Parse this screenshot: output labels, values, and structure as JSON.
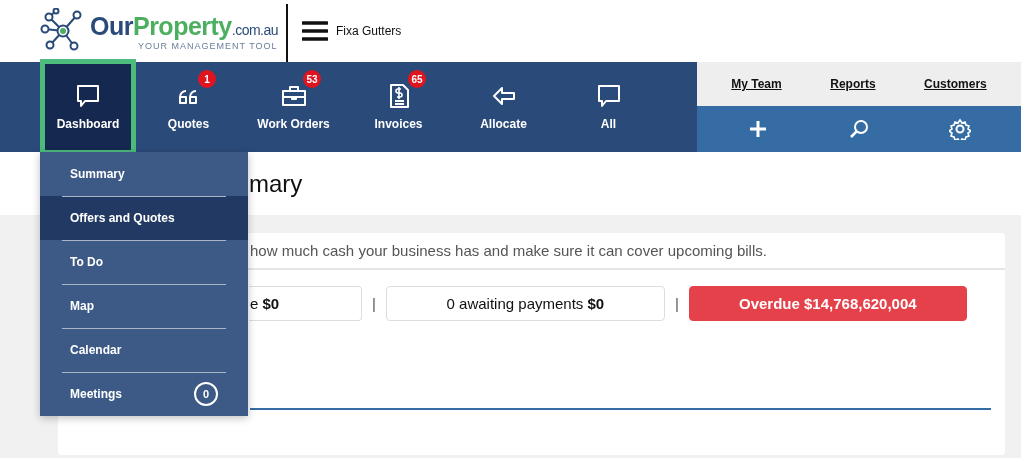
{
  "logo": {
    "brand": "Our",
    "brand_accent": "Property",
    "domain": ".com.au",
    "tagline": "YOUR MANAGEMENT TOOL"
  },
  "company": "Fixa Gutters",
  "nav": [
    {
      "label": "Dashboard",
      "selected": true
    },
    {
      "label": "Quotes",
      "badge": "1",
      "selected": false
    },
    {
      "label": "Work Orders",
      "badge": "53",
      "selected": false
    },
    {
      "label": "Invoices",
      "badge": "65",
      "selected": false
    },
    {
      "label": "Allocate",
      "selected": false
    },
    {
      "label": "All",
      "selected": false
    }
  ],
  "top_links": [
    "My Team",
    "Reports",
    "Customers"
  ],
  "page_title": "mary",
  "invoices_card": {
    "description": "how much cash your business has and make sure it can cover upcoming bills.",
    "stats": [
      {
        "kind": "partial",
        "label": "e",
        "amount": "$0"
      },
      {
        "kind": "plain",
        "label": "0 awaiting payments",
        "amount": "$0"
      },
      {
        "kind": "alert",
        "label": "Overdue",
        "amount": "$14,768,620,004"
      }
    ],
    "separator": "|"
  },
  "dropdown": [
    {
      "label": "Summary",
      "selected": false
    },
    {
      "label": "Offers and Quotes",
      "selected": true
    },
    {
      "label": "To Do",
      "selected": false
    },
    {
      "label": "Map",
      "selected": false
    },
    {
      "label": "Calendar",
      "selected": false
    },
    {
      "label": "Meetings",
      "count": "0",
      "selected": false
    }
  ]
}
